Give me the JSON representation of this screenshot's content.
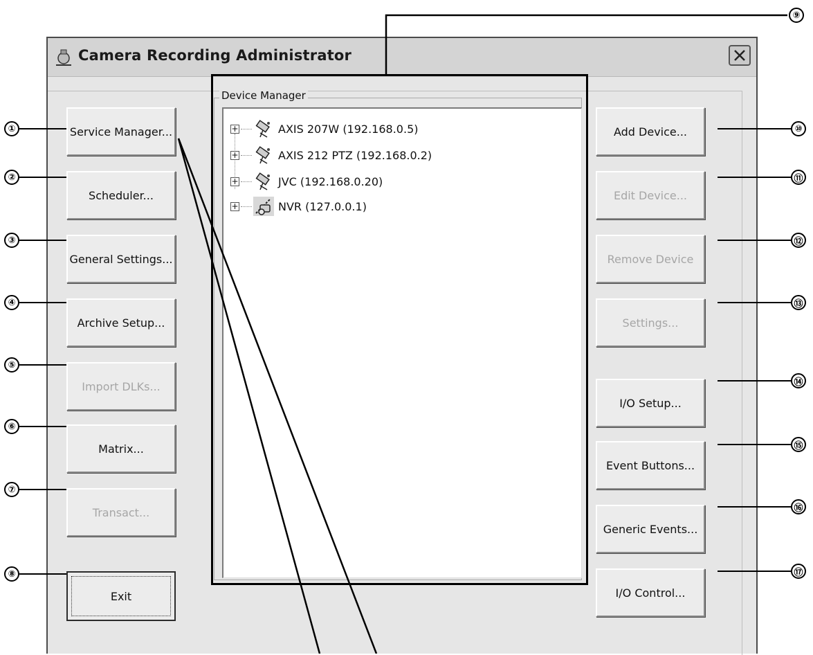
{
  "window": {
    "title": "Camera Recording Administrator"
  },
  "left_buttons": [
    {
      "label": "Service Manager...",
      "enabled": true
    },
    {
      "label": "Scheduler...",
      "enabled": true
    },
    {
      "label": "General Settings...",
      "enabled": true
    },
    {
      "label": "Archive Setup...",
      "enabled": true
    },
    {
      "label": "Import DLKs...",
      "enabled": false
    },
    {
      "label": "Matrix...",
      "enabled": true
    },
    {
      "label": "Transact...",
      "enabled": false
    }
  ],
  "exit_button": {
    "label": "Exit"
  },
  "device_manager": {
    "label": "Device Manager",
    "devices": [
      {
        "name": "AXIS 207W (192.168.0.5)",
        "icon": "camera-icon"
      },
      {
        "name": "AXIS 212 PTZ (192.168.0.2)",
        "icon": "camera-icon"
      },
      {
        "name": "JVC  (192.168.0.20)",
        "icon": "camera-icon"
      },
      {
        "name": "NVR (127.0.0.1)",
        "icon": "nvr-icon"
      }
    ]
  },
  "right_buttons": [
    {
      "label": "Add Device...",
      "enabled": true
    },
    {
      "label": "Edit Device...",
      "enabled": false
    },
    {
      "label": "Remove Device",
      "enabled": false
    },
    {
      "label": "Settings...",
      "enabled": false
    },
    {
      "label": "I/O Setup...",
      "enabled": true
    },
    {
      "label": "Event Buttons...",
      "enabled": true
    },
    {
      "label": "Generic Events...",
      "enabled": true
    },
    {
      "label": "I/O Control...",
      "enabled": true
    }
  ],
  "callouts": [
    "①",
    "②",
    "③",
    "④",
    "⑤",
    "⑥",
    "⑦",
    "⑧",
    "⑨",
    "⑩",
    "⑪",
    "⑫",
    "⑬",
    "⑭",
    "⑮",
    "⑯",
    "⑰"
  ]
}
